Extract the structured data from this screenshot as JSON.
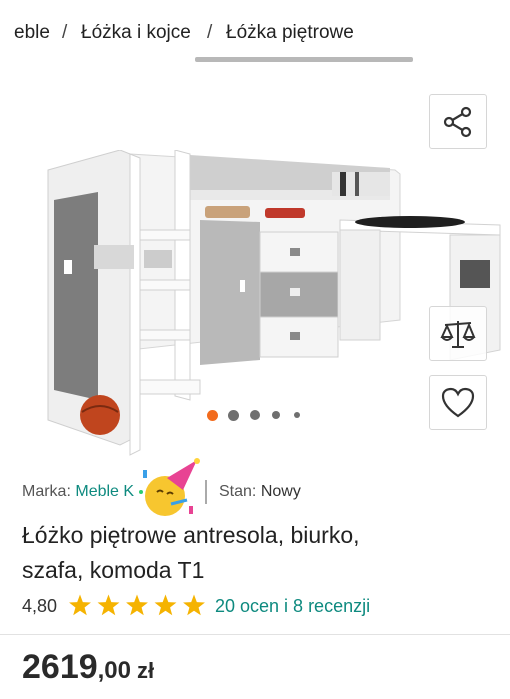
{
  "breadcrumb": {
    "items": [
      "eble",
      "Łóżka i kojce",
      "Łóżka piętrowe"
    ],
    "separator": "/"
  },
  "gallery": {
    "icons": {
      "share": "share-icon",
      "compare": "scale-compare-icon",
      "favorite": "heart-icon"
    },
    "dots_count": 5,
    "active_dot": 0,
    "accent_color": "#f26b1d"
  },
  "product": {
    "brand_label": "Marka:",
    "brand_value": "Meble K",
    "condition_label": "Stan:",
    "condition_value": "Nowy",
    "title_line1": "Łóżko piętrowe antresola, biurko,",
    "title_line2": "szafa, komoda T1",
    "rating_value": "4,80",
    "stars": 5,
    "reviews_text": "20 ocen i 8 recenzji",
    "price_main": "2619",
    "price_cents": ",00",
    "currency": "zł",
    "emoji": "party-face-emoji"
  },
  "colors": {
    "link": "#0e8a7f",
    "star": "#f5b301"
  }
}
